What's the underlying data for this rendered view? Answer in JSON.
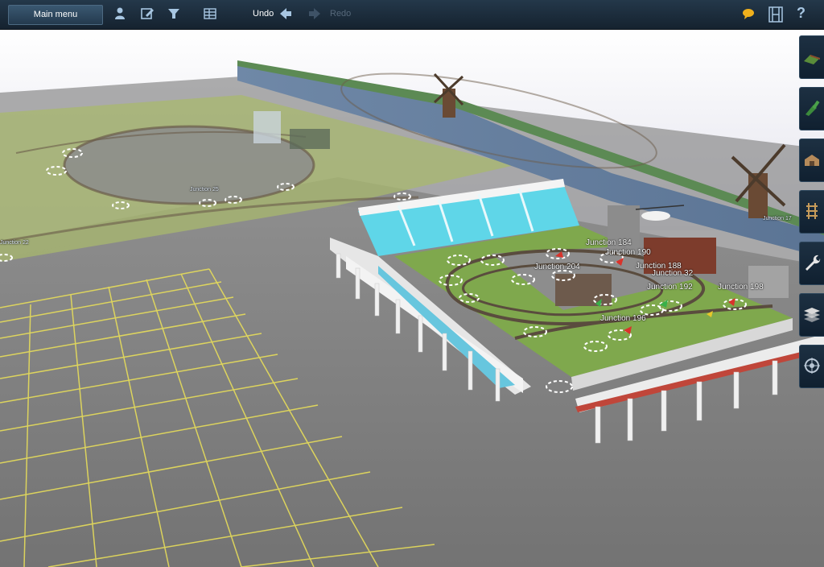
{
  "toolbar": {
    "main_menu_label": "Main menu",
    "undo_label": "Undo",
    "redo_label": "Redo",
    "icons": [
      "person-icon",
      "edit-icon",
      "filter-icon",
      "grid-icon",
      "undo-arrow-icon",
      "redo-arrow-icon",
      "chat-bubble-icon",
      "film-icon",
      "help-icon"
    ]
  },
  "side_panel": {
    "buttons": [
      "terrain-paint-icon",
      "vegetation-icon",
      "building-icon",
      "track-icon",
      "wrench-icon",
      "layers-icon",
      "settings-icon"
    ]
  },
  "scene": {
    "junctions": [
      {
        "label": "Junction 204"
      },
      {
        "label": "Junction 184"
      },
      {
        "label": "Junction 190"
      },
      {
        "label": "Junction 188"
      },
      {
        "label": "Junction 32"
      },
      {
        "label": "Junction 192"
      },
      {
        "label": "Junction 198"
      },
      {
        "label": "Junction 196"
      },
      {
        "label": "Junction 17"
      },
      {
        "label": "Junction 22"
      },
      {
        "label": "Junction 25"
      }
    ]
  },
  "colors": {
    "toolbar_bg": "#1b2b3a",
    "grid_line": "#e7dd5a",
    "grass": "#7fa84d",
    "floor": "#7d7d7d"
  }
}
